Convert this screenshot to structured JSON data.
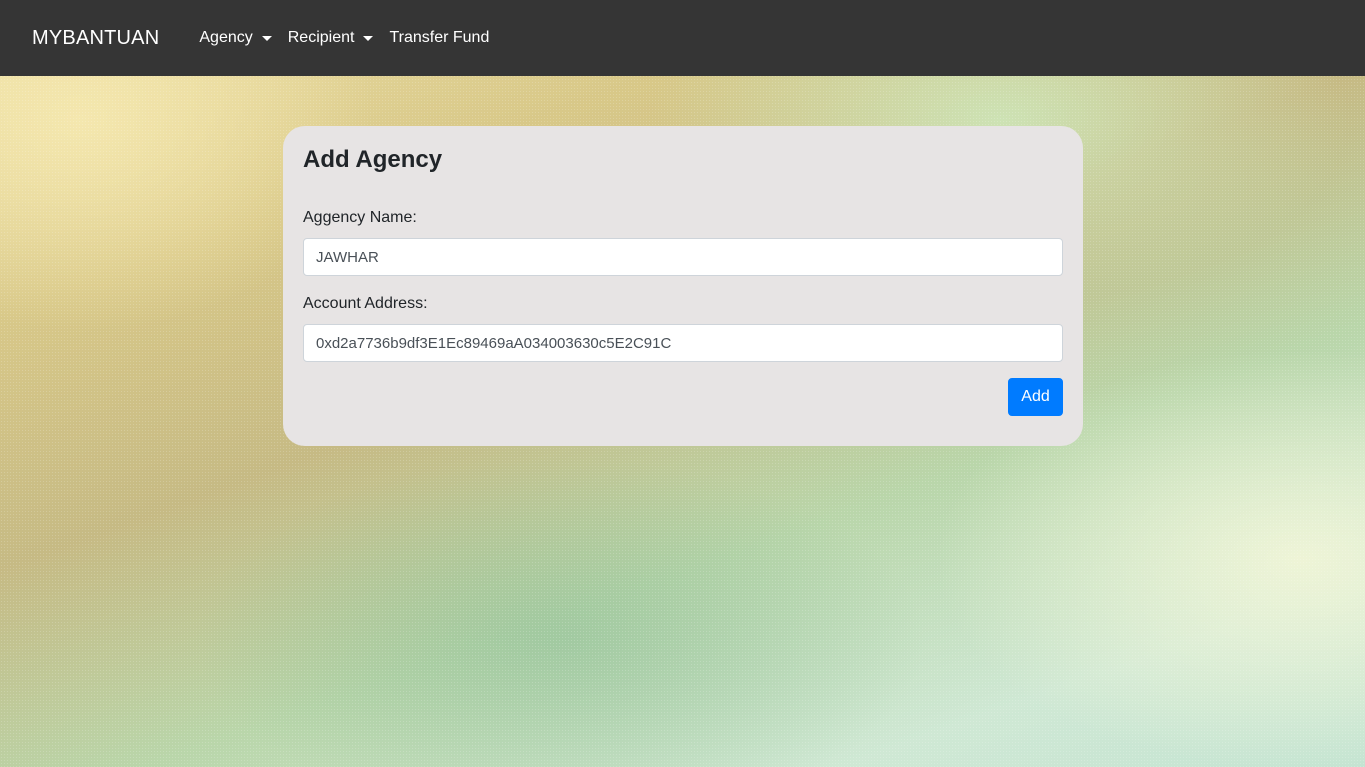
{
  "navbar": {
    "brand": "MYBANTUAN",
    "items": [
      {
        "label": "Agency",
        "dropdown": true
      },
      {
        "label": "Recipient",
        "dropdown": true
      },
      {
        "label": "Transfer Fund",
        "dropdown": false
      }
    ]
  },
  "form": {
    "title": "Add Agency",
    "name_label": "Aggency Name:",
    "name_value": "JAWHAR",
    "address_label": "Account Address:",
    "address_value": "0xd2a7736b9df3E1Ec89469aA034003630c5E2C91C",
    "submit_label": "Add"
  },
  "colors": {
    "navbar_bg": "#353535",
    "card_bg": "#e7e4e4",
    "primary_button": "#007bff"
  }
}
